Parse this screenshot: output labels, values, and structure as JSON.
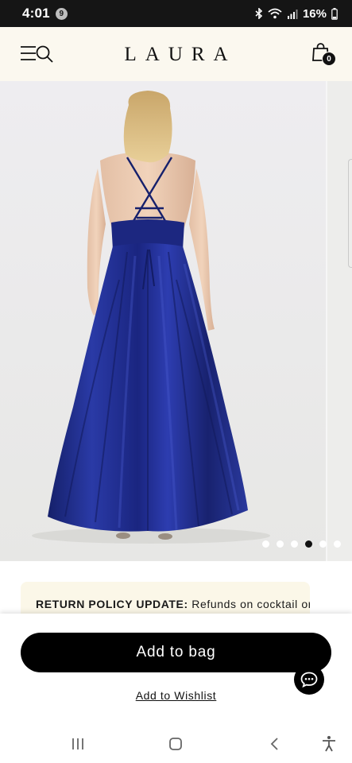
{
  "status_bar": {
    "time": "4:01",
    "notification_count": "9",
    "battery": "16%"
  },
  "header": {
    "brand": "LAURA",
    "bag_count": "0"
  },
  "gallery": {
    "slide_count": 6,
    "active_index": 3
  },
  "notice": {
    "label": "RETURN POLICY UPDATE:",
    "text": " Refunds on cocktail or"
  },
  "actions": {
    "add_to_bag": "Add to bag",
    "wishlist": "Add to Wishlist"
  },
  "colors": {
    "dress": "#1d2b86",
    "header_bg": "#fbf8ef",
    "notice_bg": "#fbf7e8",
    "button": "#000000"
  },
  "icons": [
    "menu-icon",
    "search-icon",
    "shopping-bag-icon",
    "chat-icon",
    "recent-apps-icon",
    "home-icon",
    "back-icon",
    "accessibility-icon"
  ]
}
